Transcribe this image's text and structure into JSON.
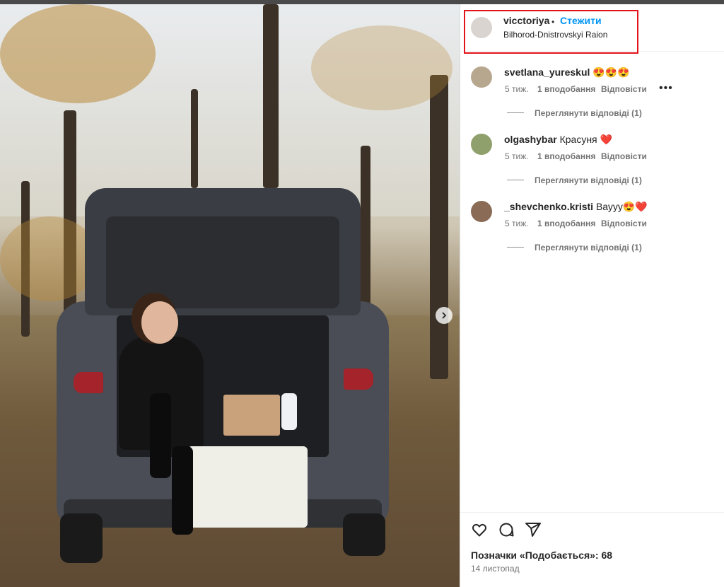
{
  "post": {
    "author": "vicctoriya",
    "separator": "•",
    "follow_label": "Стежити",
    "location": "Bilhorod-Dnistrovskyi Raion"
  },
  "comments": [
    {
      "username": "svetlana_yureskul",
      "text": "😍😍😍",
      "age": "5 тиж.",
      "likes": "1 вподобання",
      "reply_label": "Відповісти",
      "more": "•••",
      "view_replies": "Переглянути відповіді (1)"
    },
    {
      "username": "olgashybar",
      "text": "Красуня ❤️",
      "age": "5 тиж.",
      "likes": "1 вподобання",
      "reply_label": "Відповісти",
      "view_replies": "Переглянути відповіді (1)"
    },
    {
      "username": "_shevchenko.kristi",
      "text": "Вауyy😍❤️",
      "age": "5 тиж.",
      "likes": "1 вподобання",
      "reply_label": "Відповісти",
      "view_replies": "Переглянути відповіді (1)"
    }
  ],
  "footer": {
    "likes_label": "Позначки «Подобається»: 68",
    "date": "14 листопад"
  },
  "icons": {
    "like": "heart-icon",
    "comment": "comment-icon",
    "share": "share-icon",
    "next": "chevron-right-icon"
  },
  "colors": {
    "accent": "#0095f6",
    "highlight": "#e3131b"
  }
}
